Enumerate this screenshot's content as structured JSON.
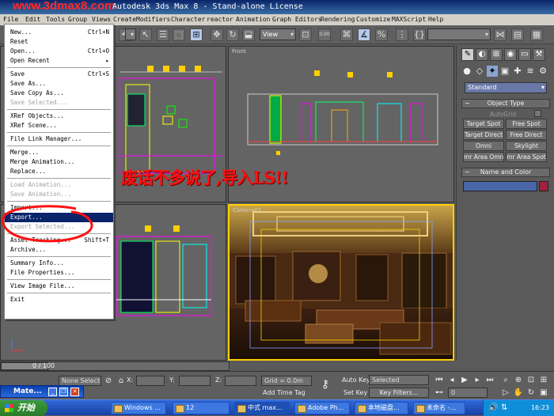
{
  "window": {
    "watermark": "www.3dmax8.com",
    "title": "Autodesk 3ds Max 8 - Stand-alone License"
  },
  "menubar": [
    "File",
    "Edit",
    "Tools",
    "Group",
    "Views",
    "Create",
    "Modifiers",
    "Character",
    "reactor",
    "Animation",
    "Graph Editors",
    "Rendering",
    "Customize",
    "MAXScript",
    "Help"
  ],
  "toolbar": {
    "view_dropdown": "View",
    "coord_values": "0.00"
  },
  "file_menu": {
    "items": [
      {
        "label": "New...",
        "shortcut": "Ctrl+N",
        "state": "normal"
      },
      {
        "label": "Reset",
        "shortcut": "",
        "state": "normal"
      },
      {
        "label": "Open...",
        "shortcut": "Ctrl+O",
        "state": "normal"
      },
      {
        "label": "Open Recent",
        "shortcut": "▸",
        "state": "normal"
      },
      {
        "sep": true
      },
      {
        "label": "Save",
        "shortcut": "Ctrl+S",
        "state": "normal"
      },
      {
        "label": "Save As...",
        "shortcut": "",
        "state": "normal"
      },
      {
        "label": "Save Copy As...",
        "shortcut": "",
        "state": "normal"
      },
      {
        "label": "Save Selected...",
        "shortcut": "",
        "state": "disabled"
      },
      {
        "sep": true
      },
      {
        "label": "XRef Objects...",
        "shortcut": "",
        "state": "normal"
      },
      {
        "label": "XRef Scene...",
        "shortcut": "",
        "state": "normal"
      },
      {
        "sep": true
      },
      {
        "label": "File Link Manager...",
        "shortcut": "",
        "state": "normal"
      },
      {
        "sep": true
      },
      {
        "label": "Merge...",
        "shortcut": "",
        "state": "normal"
      },
      {
        "label": "Merge Animation...",
        "shortcut": "",
        "state": "normal"
      },
      {
        "label": "Replace...",
        "shortcut": "",
        "state": "normal"
      },
      {
        "sep": true
      },
      {
        "label": "Load Animation...",
        "shortcut": "",
        "state": "disabled"
      },
      {
        "label": "Save Animation...",
        "shortcut": "",
        "state": "disabled"
      },
      {
        "sep": true
      },
      {
        "label": "Import...",
        "shortcut": "",
        "state": "normal"
      },
      {
        "label": "Export...",
        "shortcut": "",
        "state": "highlighted"
      },
      {
        "label": "Export Selected...",
        "shortcut": "",
        "state": "disabled"
      },
      {
        "sep": true
      },
      {
        "label": "Asset Tracking...",
        "shortcut": "Shift+T",
        "state": "normal"
      },
      {
        "label": "Archive...",
        "shortcut": "",
        "state": "normal"
      },
      {
        "sep": true
      },
      {
        "label": "Summary Info...",
        "shortcut": "",
        "state": "normal"
      },
      {
        "label": "File Properties...",
        "shortcut": "",
        "state": "normal"
      },
      {
        "sep": true
      },
      {
        "label": "View Image File...",
        "shortcut": "",
        "state": "normal"
      },
      {
        "sep": true
      },
      {
        "label": "Exit",
        "shortcut": "",
        "state": "normal"
      }
    ]
  },
  "viewports": {
    "front_label": "Front",
    "camera_label": "Camera01"
  },
  "annotation": {
    "text": "废话不多说了,导入LS!!",
    "color": "#ff1010"
  },
  "command_panel": {
    "category_dropdown": "Standard",
    "object_type_title": "Object Type",
    "autogrid_label": "AutoGrid",
    "buttons": [
      "Target Spot",
      "Free Spot",
      "Target Direct",
      "Free Direct",
      "Omni",
      "Skylight",
      "mr Area Omni",
      "mr Area Spot"
    ],
    "name_color_title": "Name and Color"
  },
  "timeline": {
    "frame": "0 / 100"
  },
  "status": {
    "selection": "None Selecte",
    "x_label": "X:",
    "y_label": "Y:",
    "z_label": "Z:",
    "grid": "Grid = 0.0m",
    "add_time_tag": "Add Time Tag",
    "auto_key": "Auto Key",
    "selected_dropdown": "Selected",
    "set_key": "Set Key",
    "key_filters": "Key Filters...",
    "frame_field": "0"
  },
  "miniwin": {
    "title": "Mate..."
  },
  "taskbar": {
    "start": "开始",
    "tasks": [
      "Windows ...",
      "12",
      "中式 max...",
      "Adobe Ph...",
      "本地磁盘...",
      "未命名 -..."
    ],
    "clock": "16:23"
  }
}
